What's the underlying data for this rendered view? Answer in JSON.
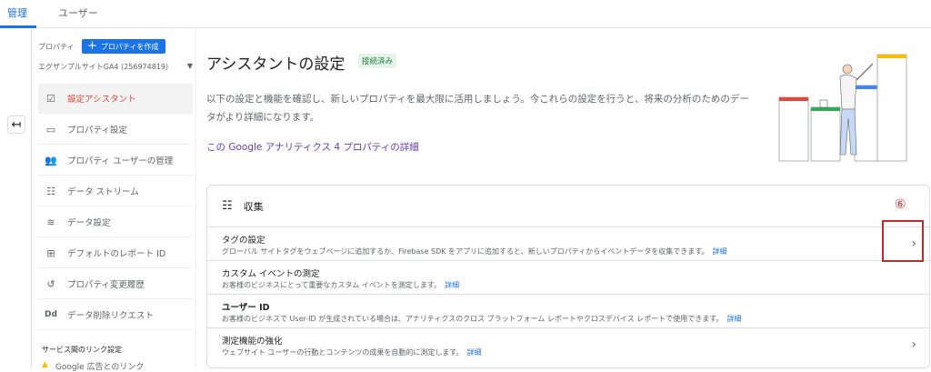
{
  "topbar": {
    "tabs": [
      "管理",
      "ユーザー"
    ]
  },
  "sidebar": {
    "property_label": "プロパティ",
    "create_button": "プロパティを作成",
    "property_select": "エグザンプルサイトGA4 (256974819)",
    "items": [
      {
        "label": "設定アシスタント",
        "icon": "checkbox-icon",
        "glyph": "☑"
      },
      {
        "label": "プロパティ設定",
        "icon": "window-icon",
        "glyph": "▭"
      },
      {
        "label": "プロパティ ユーザーの管理",
        "icon": "users-icon",
        "glyph": "👥"
      },
      {
        "label": "データ ストリーム",
        "icon": "streams-icon",
        "glyph": "☷"
      },
      {
        "label": "データ設定",
        "icon": "database-icon",
        "glyph": "≋"
      },
      {
        "label": "デフォルトのレポート ID",
        "icon": "id-icon",
        "glyph": "⊞"
      },
      {
        "label": "プロパティ変更履歴",
        "icon": "history-icon",
        "glyph": "↺"
      },
      {
        "label": "データ削除リクエスト",
        "icon": "dd-icon",
        "glyph": "Dd"
      }
    ],
    "services_label": "サービス間のリンク設定",
    "ads_link": "Google 広告とのリンク"
  },
  "main": {
    "title": "アシスタントの設定",
    "badge": "接続済み",
    "description": "以下の設定と機能を確認し、新しいプロパティを最大限に活用しましょう。今これらの設定を行うと、将来の分析のためのデータがより詳細になります。",
    "detail_link": "この Google アナリティクス 4 プロパティの詳細",
    "card_title": "収集",
    "rows": [
      {
        "title": "タグの設定",
        "desc": "グローバル サイトタグをウェブページに追加するか、Firebase SDK をアプリに追加すると、新しいプロパティからイベントデータを収集できます。",
        "link": "詳細"
      },
      {
        "title": "カスタム イベントの測定",
        "desc": "お客様のビジネスにとって重要なカスタム イベントを測定します。",
        "link": "詳細"
      },
      {
        "title": "ユーザー ID",
        "desc": "お客様のビジネスで User-ID が生成されている場合は、アナリティクスのクロス プラットフォーム レポートやクロスデバイス レポートで使用できます。",
        "link": "詳細"
      },
      {
        "title": "測定機能の強化",
        "desc": "ウェブサイト ユーザーの行動とコンテンツの成果を自動的に測定します。",
        "link": "詳細"
      }
    ]
  },
  "annotation": {
    "label": "⑥"
  },
  "colors": {
    "accent": "#1a73e8",
    "active": "#e84335",
    "annotation": "#c62828"
  }
}
